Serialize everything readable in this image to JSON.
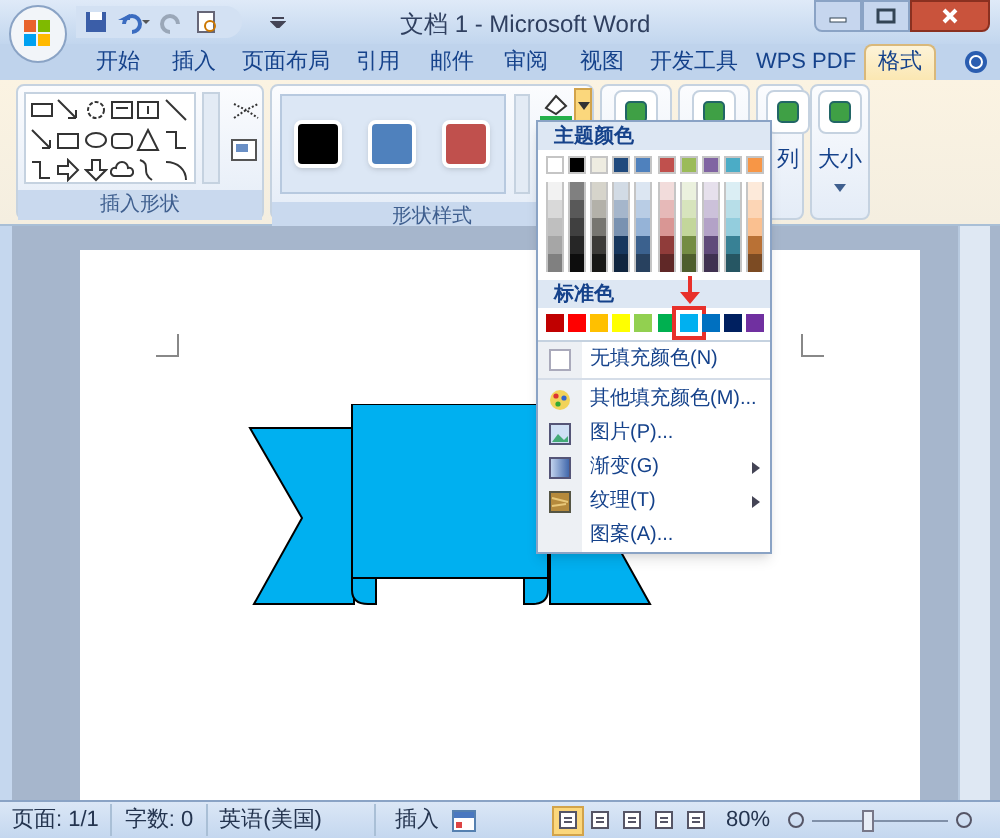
{
  "window": {
    "title": "文档 1 - Microsoft Word"
  },
  "tabs": [
    {
      "label": "开始",
      "selected": false
    },
    {
      "label": "插入",
      "selected": false
    },
    {
      "label": "页面布局",
      "selected": false
    },
    {
      "label": "引用",
      "selected": false
    },
    {
      "label": "邮件",
      "selected": false
    },
    {
      "label": "审阅",
      "selected": false
    },
    {
      "label": "视图",
      "selected": false
    },
    {
      "label": "开发工具",
      "selected": false
    },
    {
      "label": "WPS PDF",
      "selected": false
    },
    {
      "label": "格式",
      "selected": true
    }
  ],
  "ribbon_groups": [
    {
      "kind": "shapes",
      "label": "插入形状"
    },
    {
      "kind": "styles",
      "label": "形状样式",
      "styles": [
        {
          "color": "#000000"
        },
        {
          "color": "#4f81bd"
        },
        {
          "color": "#c0504d"
        }
      ]
    },
    {
      "kind": "icon"
    },
    {
      "kind": "icon"
    },
    {
      "kind": "icon_label",
      "label": "列"
    },
    {
      "kind": "icon_label",
      "label": "大小"
    }
  ],
  "fill_menu": {
    "theme_heading": "主题颜色",
    "theme_colors": [
      {
        "color": "#ffffff"
      },
      {
        "color": "#000000"
      },
      {
        "color": "#eeece1"
      },
      {
        "color": "#1f497d"
      },
      {
        "color": "#4f81bd"
      },
      {
        "color": "#c0504d"
      },
      {
        "color": "#9bbb59"
      },
      {
        "color": "#8064a2"
      },
      {
        "color": "#4bacc6"
      },
      {
        "color": "#f79646"
      }
    ],
    "standard_heading": "标准色",
    "standard_colors": [
      {
        "color": "#c00000",
        "selected": false
      },
      {
        "color": "#ff0000",
        "selected": false
      },
      {
        "color": "#ffc000",
        "selected": false
      },
      {
        "color": "#ffff00",
        "selected": false
      },
      {
        "color": "#92d050",
        "selected": false
      },
      {
        "color": "#00b050",
        "selected": false
      },
      {
        "color": "#00b0f0",
        "selected": true
      },
      {
        "color": "#0070c0",
        "selected": false
      },
      {
        "color": "#002060",
        "selected": false
      },
      {
        "color": "#7030a0",
        "selected": false
      }
    ],
    "items": [
      {
        "kind": "no_fill",
        "label": "无填充颜色(N)",
        "submenu": false
      },
      {
        "kind": "more",
        "label": "其他填充颜色(M)...",
        "submenu": false
      },
      {
        "kind": "picture",
        "label": "图片(P)...",
        "submenu": false
      },
      {
        "kind": "gradient",
        "label": "渐变(G)",
        "submenu": true
      },
      {
        "kind": "texture",
        "label": "纹理(T)",
        "submenu": true
      },
      {
        "kind": "pattern",
        "label": "图案(A)...",
        "submenu": false
      }
    ]
  },
  "status_bar": {
    "page": "页面: 1/1",
    "words": "字数: 0",
    "language": "英语(美国)",
    "mode": "插入",
    "views": [
      {
        "selected": true
      },
      {
        "selected": false
      },
      {
        "selected": false
      },
      {
        "selected": false
      },
      {
        "selected": false
      }
    ],
    "zoom": "80%",
    "zoom_slider": {
      "level": 0.41
    }
  }
}
